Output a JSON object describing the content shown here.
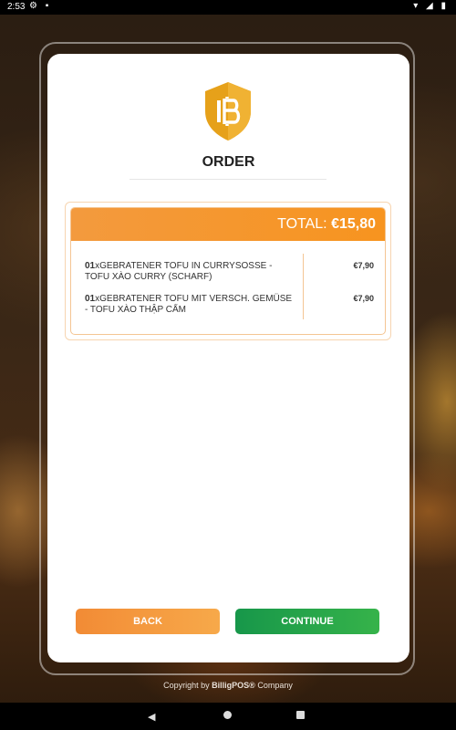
{
  "status_bar": {
    "time": "2:53",
    "left_icons": "⚙ ▪",
    "right_icons": "▾ ◢ ▮"
  },
  "header": {
    "title": "ORDER"
  },
  "order": {
    "total_label": "TOTAL:",
    "total_value": "€15,80",
    "items": [
      {
        "qty": "01",
        "name": "xGEBRATENER TOFU IN CURRYSOSSE - TOFU XÀO CURRY (SCHARF)",
        "price": "€7,90"
      },
      {
        "qty": "01",
        "name": "xGEBRATENER TOFU MIT VERSCH. GEMÜSE - TOFU XÀO THẬP CẨM",
        "price": "€7,90"
      }
    ]
  },
  "buttons": {
    "back": "BACK",
    "continue": "CONTINUE"
  },
  "footer": {
    "prefix": "Copyright by ",
    "brand": "BilligPOS®",
    "suffix": " Company"
  },
  "nav": {
    "back_glyph": "◀"
  },
  "colors": {
    "accent_orange": "#f7941f",
    "continue_green": "#1e9e4a",
    "logo_gold": "#e6a11a"
  }
}
